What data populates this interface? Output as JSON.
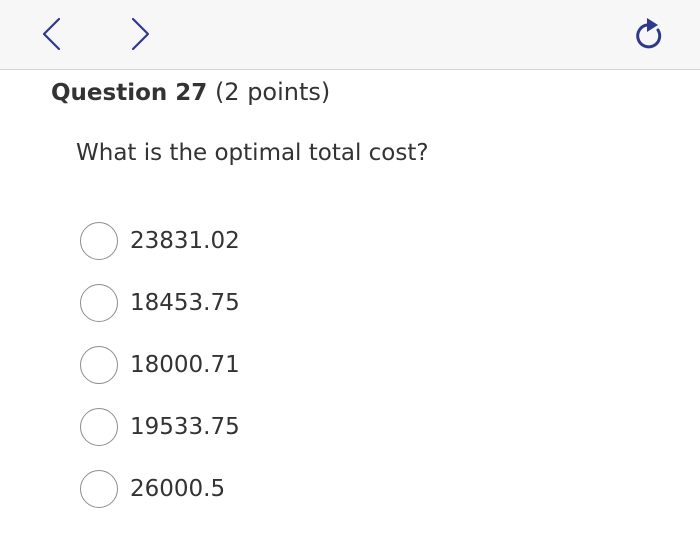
{
  "nav": {
    "back_icon": "chevron-left-icon",
    "forward_icon": "chevron-right-icon",
    "reload_icon": "reload-icon",
    "icon_color": "#2e3a8c"
  },
  "question": {
    "label": "Question 27",
    "points": "(2 points)",
    "prompt": "What is the optimal total cost?",
    "options": [
      {
        "label": "23831.02"
      },
      {
        "label": "18453.75"
      },
      {
        "label": "18000.71"
      },
      {
        "label": "19533.75"
      },
      {
        "label": "26000.5"
      }
    ]
  }
}
